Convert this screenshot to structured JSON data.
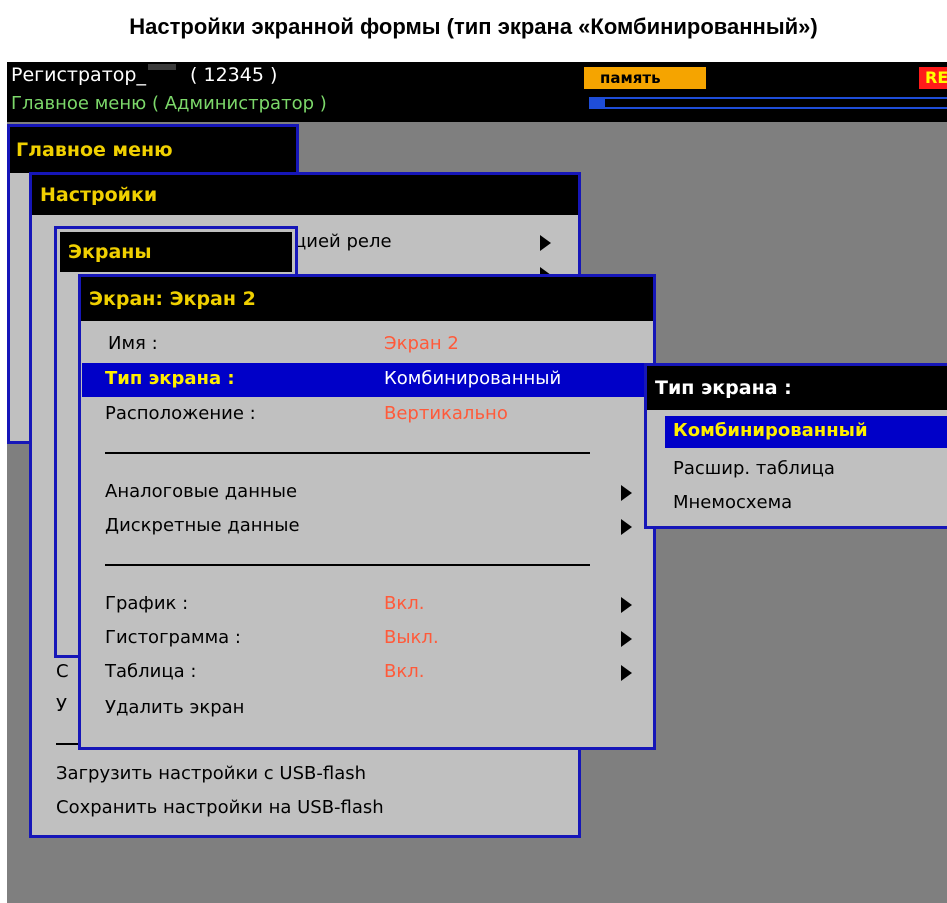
{
  "caption": "Настройки экранной формы (тип экрана «Комбинированный»)",
  "header": {
    "device_name": "Регистратор_",
    "device_id": "( 12345 )",
    "subtitle": "Главное меню ( Администратор )",
    "memory_label": "память",
    "rec_label": "RE",
    "memory_progress_percent": 4
  },
  "main_menu": {
    "title": "Главное меню"
  },
  "settings_menu": {
    "title": "Настройки",
    "relay_item_partial": "цией реле",
    "partial_items": [
      "С",
      "У"
    ],
    "load_usb": "Загрузить настройки с USB-flash",
    "save_usb": "Сохранить настройки на USB-flash"
  },
  "screens_menu": {
    "title": "Экраны"
  },
  "screen_panel": {
    "title": "Экран: Экран 2",
    "name_label": "Имя :",
    "name_value": "Экран 2",
    "type_label": "Тип экрана :",
    "type_value": "Комбинированный",
    "layout_label": "Расположение :",
    "layout_value": "Вертикально",
    "analog_label": "Аналоговые данные",
    "discrete_label": "Дискретные данные",
    "graph_label": "График :",
    "graph_value": "Вкл.",
    "histogram_label": "Гистограмма :",
    "histogram_value": "Выкл.",
    "table_label": "Таблица :",
    "table_value": "Вкл.",
    "delete_label": "Удалить экран"
  },
  "type_popup": {
    "title": "Тип экрана :",
    "options": [
      "Комбинированный",
      "Расшир. таблица",
      "Мнемосхема"
    ],
    "selected": "Комбинированный"
  },
  "colors": {
    "panel_border": "#1616b8",
    "highlight": "#0000c8",
    "title_text": "#f0d000",
    "value_text": "#ff5a3a",
    "screen_bg": "#7f7f7f",
    "panel_bg": "#c0c0c0"
  }
}
